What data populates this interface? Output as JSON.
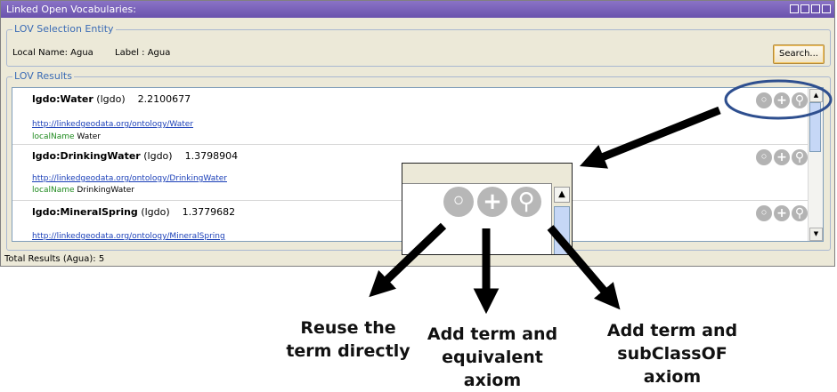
{
  "window": {
    "title": "Linked Open Vocabularies:",
    "controls": [
      "minimize-icon",
      "restore-icon",
      "maximize-icon",
      "close-icon"
    ]
  },
  "selection": {
    "legend": "LOV Selection Entity",
    "local_name": "Local Name: Agua",
    "label": "Label : Agua",
    "search_label": "Search..."
  },
  "results": {
    "legend": "LOV Results",
    "items": [
      {
        "term": "lgdo:Water",
        "vocab": "(lgdo)",
        "score": "2.2100677",
        "uri": "http://linkedgeodata.org/ontology/Water",
        "ln_key": "localName",
        "ln_val": "Water"
      },
      {
        "term": "lgdo:DrinkingWater",
        "vocab": "(lgdo)",
        "score": "1.3798904",
        "uri": "http://linkedgeodata.org/ontology/DrinkingWater",
        "ln_key": "localName",
        "ln_val": "DrinkingWater"
      },
      {
        "term": "lgdo:MineralSpring",
        "vocab": "(lgdo)",
        "score": "1.3779682",
        "uri": "http://linkedgeodata.org/ontology/MineralSpring"
      }
    ]
  },
  "status": "Total Results (Agua): 5",
  "annotations": {
    "reuse": [
      "Reuse the",
      "term directly"
    ],
    "equivalent": [
      "Add term and",
      "equivalent axiom"
    ],
    "subclass": [
      "Add term and",
      "subClassOF axiom"
    ]
  },
  "colors": {
    "title_bar": "#6a52ad",
    "legend": "#3a6bb5",
    "link": "#1a3fb8",
    "local_name_key": "#1f8a1f",
    "highlight_ellipse": "#2e4f8f"
  }
}
